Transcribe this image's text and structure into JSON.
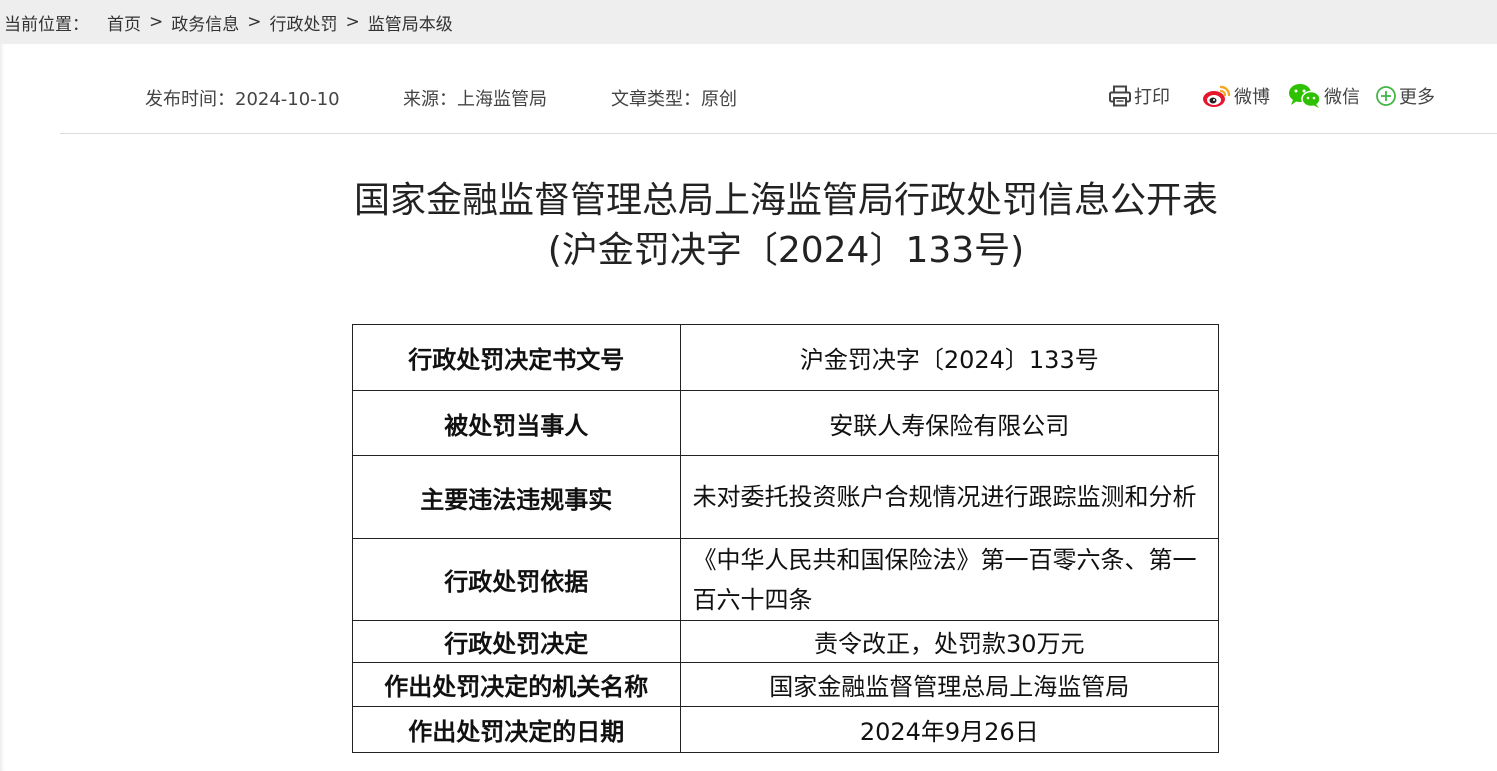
{
  "breadcrumb": {
    "label": "当前位置：",
    "items": [
      "首页",
      "政务信息",
      "行政处罚",
      "监管局本级"
    ],
    "separator": ">"
  },
  "meta": {
    "date": "发布时间：2024-10-10",
    "source": "来源：上海监管局",
    "type": "文章类型：原创"
  },
  "share": {
    "print": "打印",
    "weibo": "微博",
    "wechat": "微信",
    "more": "更多"
  },
  "title": {
    "main": "国家金融监督管理总局上海监管局行政处罚信息公开表",
    "sub": "(沪金罚决字〔2024〕133号)"
  },
  "table": {
    "rows": [
      {
        "label": "行政处罚决定书文号",
        "value": "沪金罚决字〔2024〕133号"
      },
      {
        "label": "被处罚当事人",
        "value": "安联人寿保险有限公司"
      },
      {
        "label": "主要违法违规事实",
        "value": "未对委托投资账户合规情况进行跟踪监测和分析"
      },
      {
        "label": "行政处罚依据",
        "value": "《中华人民共和国保险法》第一百零六条、第一百六十四条"
      },
      {
        "label": "行政处罚决定",
        "value": "责令改正，处罚款30万元"
      },
      {
        "label": "作出处罚决定的机关名称",
        "value": "国家金融监督管理总局上海监管局"
      },
      {
        "label": "作出处罚决定的日期",
        "value": "2024年9月26日"
      }
    ]
  },
  "colors": {
    "weibo_red": "#e6162d",
    "weibo_orange": "#f5a623",
    "wechat_green": "#2dc100",
    "more_green": "#44b549"
  }
}
